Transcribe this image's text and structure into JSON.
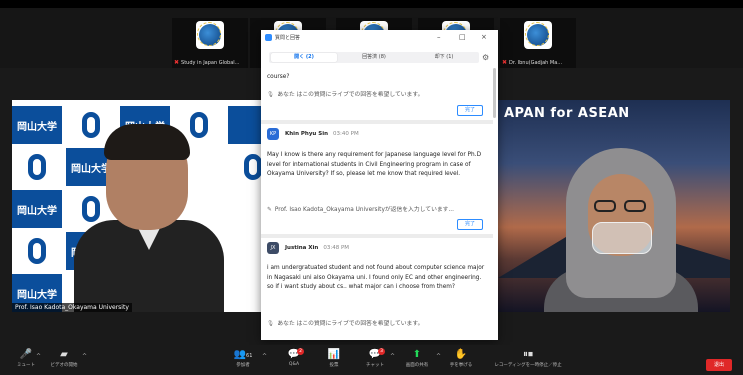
{
  "thumbnails": [
    {
      "name": "Study in Japan Global..."
    },
    {
      "name": ""
    },
    {
      "name": ""
    },
    {
      "name": ""
    },
    {
      "name": "Dr. Ibnu(Gadjah Ma..."
    }
  ],
  "left_video": {
    "participant_name": "Prof. Isao Kadota_Okayama University",
    "backdrop_text": "岡山大学"
  },
  "right_video": {
    "banner_text": "APAN for ASEAN"
  },
  "qa_window": {
    "title": "質問と回答",
    "minimize": "–",
    "maximize": "□",
    "close": "×",
    "tabs": [
      {
        "label": "開く (2)",
        "active": true
      },
      {
        "label": "回答済 (8)",
        "active": false
      },
      {
        "label": "却下 (1)",
        "active": false
      }
    ],
    "gear": "⚙",
    "entries": [
      {
        "question_tail": "course?",
        "note": "あなた はこの質問にライブでの回答を希望しています。",
        "button": "完了"
      },
      {
        "initials": "KP",
        "asker": "Khin Phyu Sin",
        "time": "03:40 PM",
        "question": "May I know is there any requirement for Japanese language level for Ph.D level for international students in Civil Engineering program in case of Okayama University? If so, please let me know that required level.",
        "note": "Prof. Isao Kadota_Okayama Universityが返信を入力しています...",
        "button": "完了"
      },
      {
        "initials": "JX",
        "asker": "Justina Xin",
        "time": "03:48 PM",
        "question": "i am undergratuated student and not found about computer science major in Nagasaki uni also Okayama uni. I found only EC and other engineering. so if i want study about cs.. what major can i choose from them?",
        "note": "あなた はこの質問にライブでの回答を希望しています。"
      }
    ]
  },
  "toolbar": {
    "items": [
      {
        "label": "ミュート",
        "icon": "mic-icon"
      },
      {
        "label": "ビデオの開始",
        "icon": "video-off-icon"
      },
      {
        "label": "参加者",
        "icon": "participants-icon",
        "count": "61"
      },
      {
        "label": "Q&A",
        "icon": "qa-icon",
        "badge": "2"
      },
      {
        "label": "投票",
        "icon": "polling-icon"
      },
      {
        "label": "チャット",
        "icon": "chat-icon",
        "badge": "3"
      },
      {
        "label": "画面の共有",
        "icon": "share-screen-icon"
      },
      {
        "label": "手を挙げる",
        "icon": "raise-hand-icon"
      },
      {
        "label": "レコーディングを一時停止／停止",
        "icon": "recording-icon"
      }
    ],
    "leave_label": "退出"
  },
  "colors": {
    "zoom_blue": "#2d8cff",
    "share_green": "#23d959",
    "leave_red": "#e02828",
    "okayama_blue": "#0b4e9b"
  }
}
